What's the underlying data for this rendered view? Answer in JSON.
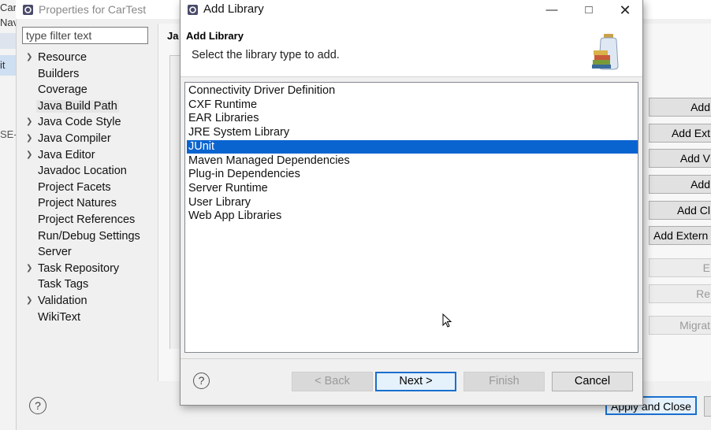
{
  "background_ide": {
    "fragments": [
      "CarTes",
      "Nav",
      "it",
      "SE-"
    ]
  },
  "properties": {
    "title": "Properties for CarTest",
    "filter_placeholder": "type filter text",
    "tab_fragment": "Ja",
    "tree": [
      {
        "label": "Resource",
        "expandable": true
      },
      {
        "label": "Builders",
        "expandable": false
      },
      {
        "label": "Coverage",
        "expandable": false
      },
      {
        "label": "Java Build Path",
        "expandable": false,
        "selected": true
      },
      {
        "label": "Java Code Style",
        "expandable": true
      },
      {
        "label": "Java Compiler",
        "expandable": true
      },
      {
        "label": "Java Editor",
        "expandable": true
      },
      {
        "label": "Javadoc Location",
        "expandable": false
      },
      {
        "label": "Project Facets",
        "expandable": false
      },
      {
        "label": "Project Natures",
        "expandable": false
      },
      {
        "label": "Project References",
        "expandable": false
      },
      {
        "label": "Run/Debug Settings",
        "expandable": false
      },
      {
        "label": "Server",
        "expandable": false
      },
      {
        "label": "Task Repository",
        "expandable": true
      },
      {
        "label": "Task Tags",
        "expandable": false
      },
      {
        "label": "Validation",
        "expandable": true
      },
      {
        "label": "WikiText",
        "expandable": false
      }
    ],
    "side_buttons": [
      {
        "label": "Add",
        "enabled": true
      },
      {
        "label": "Add Ext",
        "enabled": true
      },
      {
        "label": "Add V",
        "enabled": true
      },
      {
        "label": "Add",
        "enabled": true
      },
      {
        "label": "Add Cl",
        "enabled": true
      },
      {
        "label": "Add Extern",
        "enabled": true
      },
      {
        "label": "E",
        "enabled": false
      },
      {
        "label": "Re",
        "enabled": false
      },
      {
        "label": "Migrat",
        "enabled": false
      }
    ],
    "apply_close_label": "Apply and Close"
  },
  "dialog": {
    "window_title": "Add Library",
    "heading": "Add Library",
    "description": "Select the library type to add.",
    "library_types": [
      "Connectivity Driver Definition",
      "CXF Runtime",
      "EAR Libraries",
      "JRE System Library",
      "JUnit",
      "Maven Managed Dependencies",
      "Plug-in Dependencies",
      "Server Runtime",
      "User Library",
      "Web App Libraries"
    ],
    "selected_index": 4,
    "buttons": {
      "back": "< Back",
      "next": "Next >",
      "finish": "Finish",
      "cancel": "Cancel"
    },
    "help_glyph": "?"
  }
}
